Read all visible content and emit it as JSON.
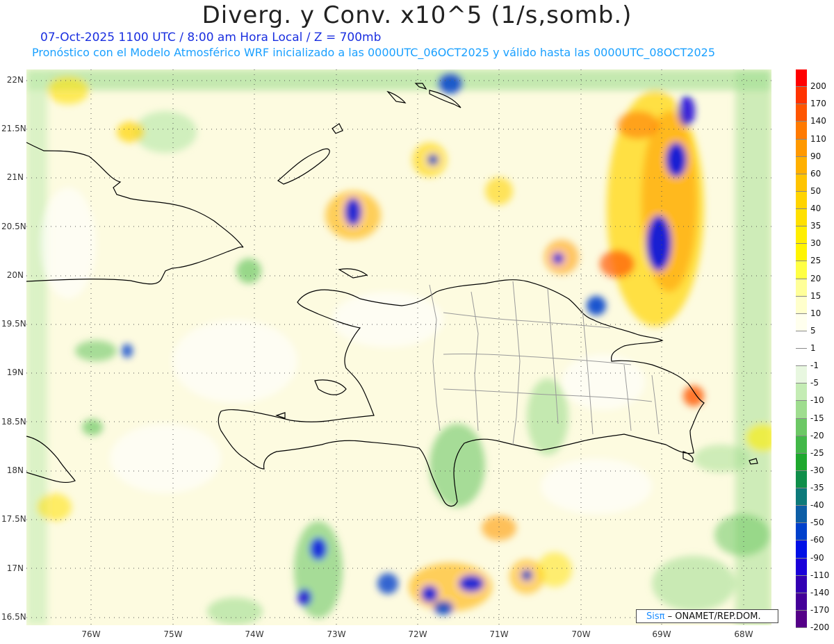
{
  "title": "Diverg. y Conv. x10^5 (1/s,somb.)",
  "subtitle_date": "07-Oct-2025  1100 UTC / 8:00 am Hora Local / Z = 700mb",
  "subtitle_model": "Pronóstico con el Modelo Atmosférico WRF inicializado a las 0000UTC_06OCT2025 y válido hasta las  0000UTC_08OCT2025",
  "lat_labels": [
    "22N",
    "21.5N",
    "21N",
    "20.5N",
    "20N",
    "19.5N",
    "19N",
    "18.5N",
    "18N",
    "17.5N",
    "17N",
    "16.5N"
  ],
  "lon_labels": [
    "76W",
    "75W",
    "74W",
    "73W",
    "72W",
    "71W",
    "70W",
    "69W",
    "68W"
  ],
  "colorbar": {
    "labels": [
      "200",
      "170",
      "140",
      "110",
      "90",
      "60",
      "50",
      "40",
      "35",
      "30",
      "25",
      "20",
      "15",
      "10",
      "5",
      "1",
      "-1",
      "-5",
      "-10",
      "-15",
      "-20",
      "-25",
      "-30",
      "-35",
      "-40",
      "-50",
      "-60",
      "-90",
      "-110",
      "-140",
      "-170",
      "-200"
    ],
    "colors": [
      "#ff0000",
      "#ff3300",
      "#ff5500",
      "#ff7a00",
      "#ff9900",
      "#ffb000",
      "#ffc400",
      "#ffd400",
      "#ffe000",
      "#ffee00",
      "#fff400",
      "#ffff44",
      "#ffff99",
      "#ffffcc",
      "#ffffee",
      "#ffffff",
      "#ffffff",
      "#e8f7e0",
      "#c4ecb4",
      "#9fdd8f",
      "#6cc865",
      "#42b848",
      "#1ea82e",
      "#0f8f4a",
      "#0d7a7a",
      "#0d5ea6",
      "#0040cc",
      "#0010e6",
      "#1a00d9",
      "#3300b3",
      "#440099",
      "#550088"
    ]
  },
  "credit": {
    "brand": "Sisπ",
    "text": "– ONAMET/REP.DOM."
  },
  "map_colors": {
    "land_border": "#000000",
    "province_border": "#999999",
    "grid": "#555555"
  }
}
